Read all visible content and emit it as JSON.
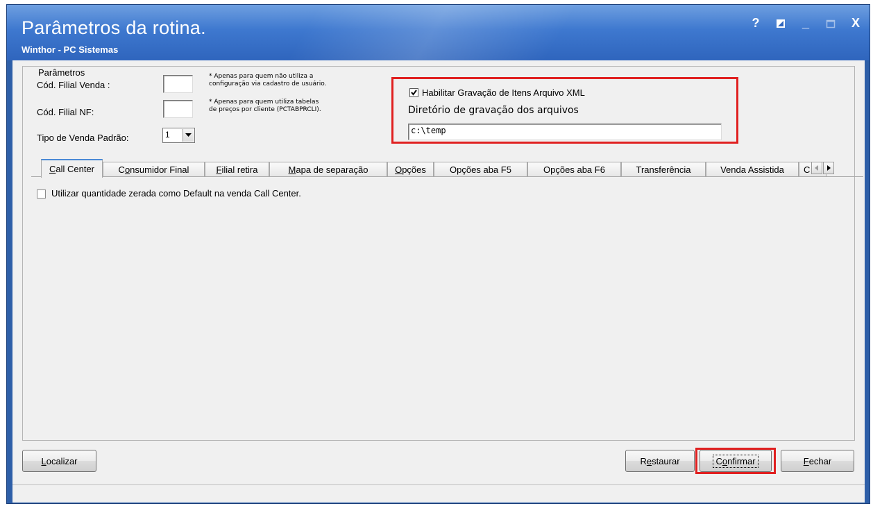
{
  "window": {
    "title": "Parâmetros da rotina.",
    "subtitle": "Winthor - PC Sistemas",
    "controls": {
      "help": "?",
      "minimize": "_",
      "maximize": "□",
      "close": "X"
    }
  },
  "params": {
    "group_label": "Parâmetros",
    "filial_venda_label": "Cód. Filial Venda :",
    "filial_venda_value": "",
    "filial_venda_note_line1": "* Apenas para quem não utiliza a",
    "filial_venda_note_line2": "configuração via cadastro de usuário.",
    "filial_nf_label": "Cód. Filial NF:",
    "filial_nf_value": "",
    "filial_nf_note_line1": "* Apenas para quem utiliza tabelas",
    "filial_nf_note_line2": "de preços por cliente (PCTABPRCLI).",
    "tipo_venda_label": "Tipo de Venda Padrão:",
    "tipo_venda_value": "1"
  },
  "xml": {
    "checkbox_label": "Habilitar Gravação de Itens Arquivo XML",
    "checked": true,
    "dir_label": "Diretório de gravação dos arquivos",
    "dir_value": "c:\\temp"
  },
  "tabs": [
    {
      "label": "Call Center",
      "accel": "C",
      "rest": "all Center",
      "active": true
    },
    {
      "label": "Consumidor Final",
      "pre": "C",
      "accel": "o",
      "rest": "nsumidor Final"
    },
    {
      "label": "Filial retira",
      "accel": "F",
      "rest": "ilial retira"
    },
    {
      "label": "Mapa de separação",
      "accel": "M",
      "rest": "apa de separação"
    },
    {
      "label": "Opções",
      "accel": "O",
      "rest": "pções"
    },
    {
      "label": "Opções aba F5"
    },
    {
      "label": "Opções aba F6"
    },
    {
      "label": "Transferência"
    },
    {
      "label": "Venda Assistida"
    },
    {
      "label": "C"
    }
  ],
  "callcenter": {
    "option_label": "Utilizar quantidade zerada como Default na venda Call Center.",
    "checked": false
  },
  "buttons": {
    "localizar": {
      "accel": "L",
      "rest": "ocalizar"
    },
    "restaurar": {
      "pre": "R",
      "accel": "e",
      "rest": "staurar"
    },
    "confirmar": {
      "pre": "C",
      "accel": "o",
      "rest": "nfirmar"
    },
    "fechar": {
      "accel": "F",
      "rest": "echar"
    }
  },
  "highlight_color": "#e02020"
}
